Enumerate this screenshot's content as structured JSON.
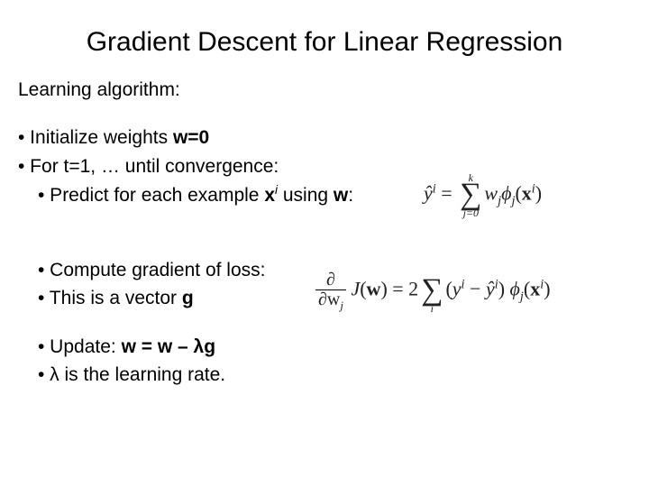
{
  "title": "Gradient Descent for Linear Regression",
  "heading": "Learning algorithm:",
  "bullets": {
    "init_pre": "• Initialize weights ",
    "init_bold": "w=0",
    "loop": "• For t=1, … until convergence:",
    "predict_pre": "• Predict for each example ",
    "predict_x": "x",
    "predict_sup": "i",
    "predict_post": " using ",
    "predict_w": "w",
    "predict_colon": ":",
    "grad": "• Compute gradient of loss:",
    "vec_pre": "• This is a vector ",
    "vec_g": "g",
    "update_pre": "• Update: ",
    "update_expr": "w = w – λg",
    "lr": "• λ is the learning rate."
  },
  "formula_yhat": {
    "yhat": "ŷ",
    "sup_i": "i",
    "eq": " = ",
    "sum_top": "k",
    "sum_sigma": "∑",
    "sum_bot": "j=0",
    "w": "w",
    "sub_j": "j",
    "phi": "ϕ",
    "lpar": "(",
    "x": "x",
    "rpar": ")"
  },
  "formula_grad": {
    "d": "∂",
    "dw": "∂w",
    "sub_j": "j",
    "J": "J",
    "lpar": "(",
    "w": "w",
    "rpar": ")",
    "eq": " = 2",
    "sigma": "∑",
    "sum_bot": "i",
    "lpar2": "(",
    "y": "y",
    "sup_i": "i",
    "minus": " − ",
    "yhat": "ŷ",
    "rpar2": ") ",
    "phi": "ϕ",
    "sub_j2": "j",
    "lpar3": "(",
    "x": "x",
    "rpar3": ")"
  }
}
